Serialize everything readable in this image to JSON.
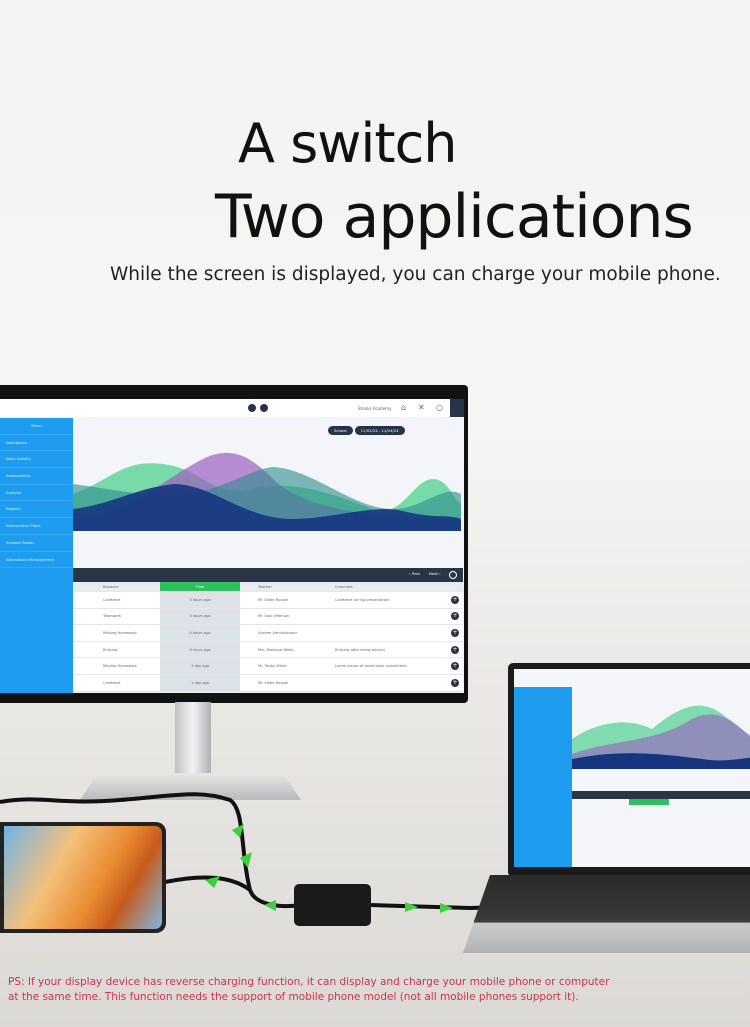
{
  "headline": {
    "line1": "A switch",
    "line2": "Two applications",
    "subtitle": "While the screen is displayed, you can charge your mobile phone."
  },
  "monitor": {
    "brand": "Brooks Academy",
    "menu_title": "Menu",
    "menu_items": [
      "Dashboard",
      "Daily Activity",
      "Assessments",
      "Analyze",
      "Reports",
      "Intervention Plans",
      "Student Roster",
      "Attendance Management"
    ],
    "filter_label": "School",
    "date_range": "11/02/24 - 11/04/24",
    "pager": {
      "prev": "‹ Prev",
      "next": "Next ›"
    },
    "table_headers": [
      "Behavior",
      "Time",
      "Teacher",
      "Comment"
    ],
    "rows": [
      [
        "Confident",
        "3 hours ago",
        "Mr. Eddie Russell",
        "Confident during presentation"
      ],
      [
        "Teamwork",
        "3 hours ago",
        "Mr. Saul Jefferson",
        ""
      ],
      [
        "Missing Homework",
        "4 hours ago",
        "System Administrator",
        ""
      ],
      [
        "Bullying",
        "6 hours ago",
        "Mrs. Monique Watts",
        "Bullying after being warned"
      ],
      [
        "Missing Homework",
        "1 day ago",
        "Mr. Tobby White",
        "Lorem ipsum sit amet dolor consectetur"
      ],
      [
        "Confident",
        "1 day ago",
        "Mr. Eddie Russell",
        ""
      ]
    ],
    "colors": {
      "sidebar": "#1e9cf0",
      "time_header": "#2fbf5f",
      "dark": "#27344a"
    }
  },
  "footnote": "PS: If your display device has reverse charging function, it can display and charge your mobile phone or computer at the same time. This function needs the support of mobile phone model (not all mobile phones support it).",
  "colors": {
    "footnote": "#c8344a",
    "arrow": "#3ecf3e"
  }
}
